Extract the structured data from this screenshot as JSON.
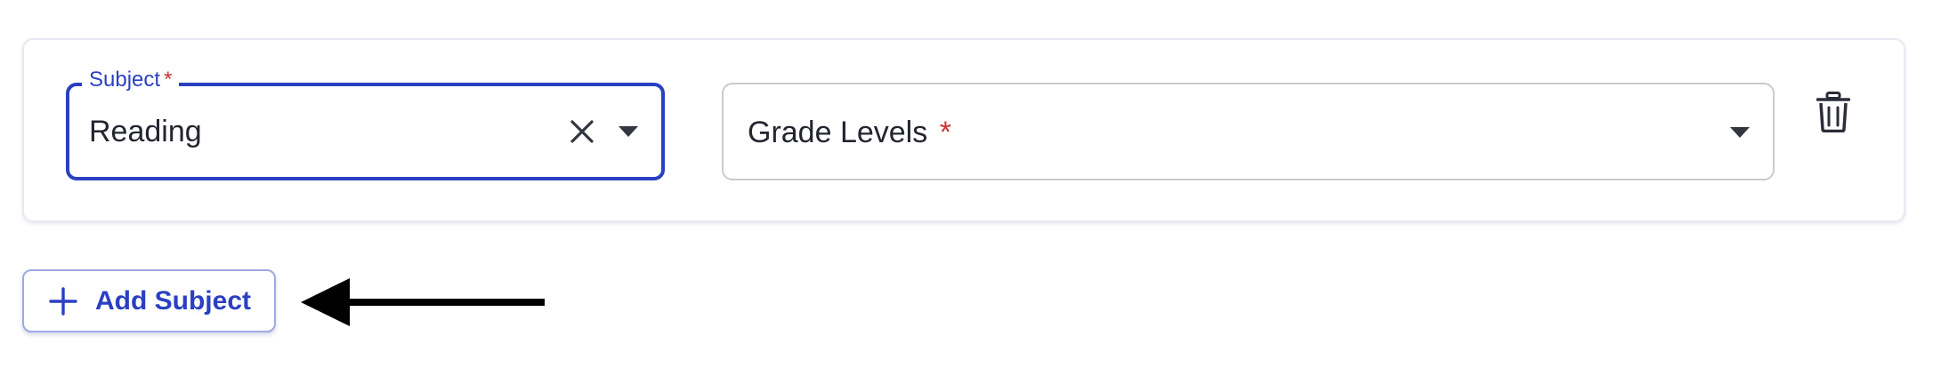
{
  "subject_field": {
    "label": "Subject",
    "required_mark": "*",
    "value": "Reading",
    "clear_icon": "close-icon",
    "dropdown_icon": "caret-down-icon"
  },
  "grade_levels_field": {
    "placeholder": "Grade Levels",
    "required_mark": "*",
    "dropdown_icon": "caret-down-icon"
  },
  "delete_button": {
    "icon": "trash-icon"
  },
  "add_subject_button": {
    "icon": "plus-icon",
    "label": "Add Subject"
  },
  "annotation": {
    "icon": "arrow-left-icon"
  },
  "colors": {
    "primary": "#2a40c1",
    "required": "#d32f2f",
    "text": "#23252f",
    "border_muted": "#c9cace"
  }
}
